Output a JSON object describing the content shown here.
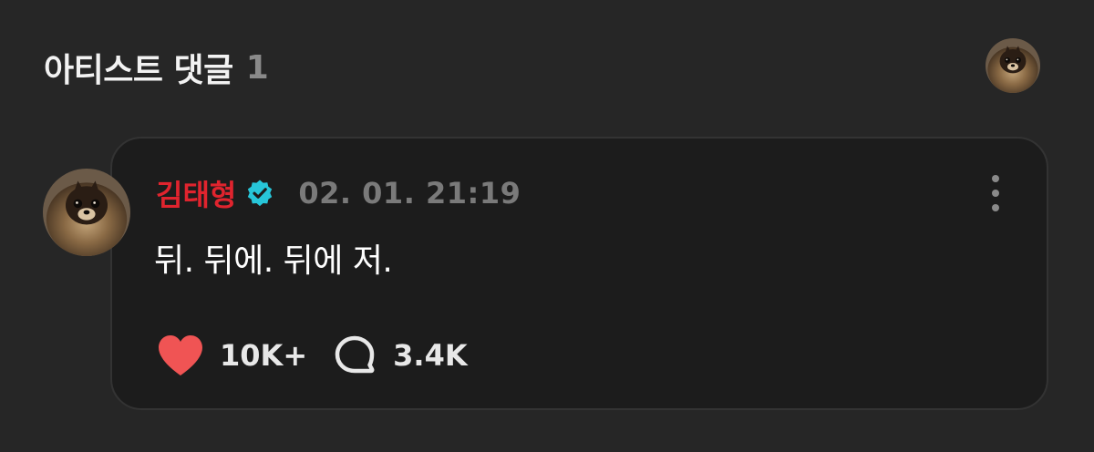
{
  "header": {
    "title": "아티스트 댓글",
    "count": "1",
    "avatar_icon": "profile-avatar"
  },
  "comment": {
    "author": "김태형",
    "verified_icon": "verified-badge-icon",
    "timestamp": "02. 01. 21:19",
    "text": "뒤. 뒤에. 뒤에 저.",
    "likes": "10K+",
    "replies": "3.4K",
    "more_icon": "more-vertical-icon"
  },
  "colors": {
    "background": "#262626",
    "card": "#1c1c1c",
    "author_red": "#e0242e",
    "verified_cyan": "#27c6d9",
    "heart_red": "#f05454",
    "muted": "#7a7a7a"
  }
}
